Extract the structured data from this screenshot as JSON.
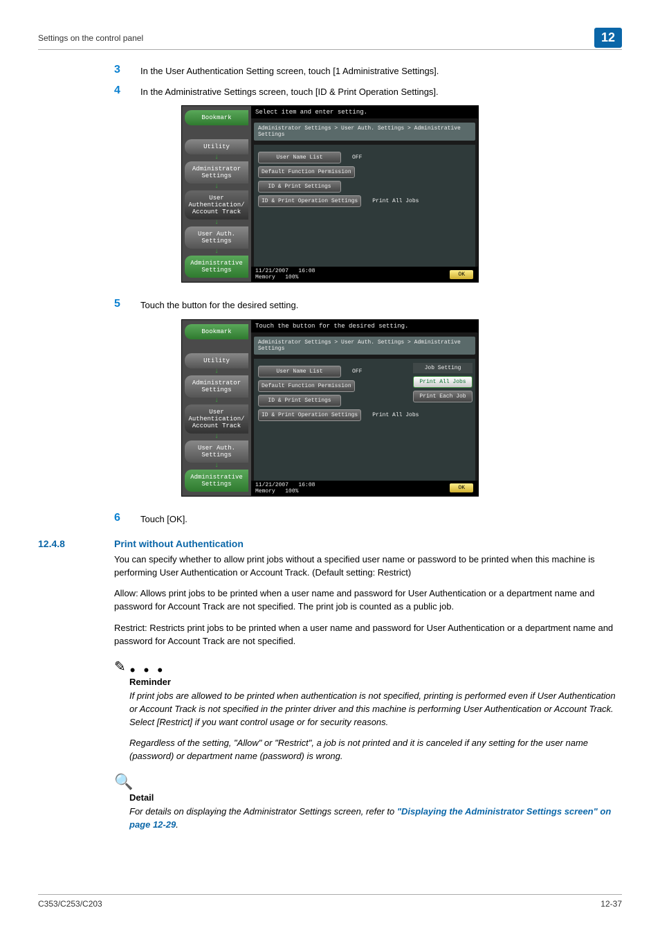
{
  "header": {
    "title": "Settings on the control panel",
    "chapter": "12"
  },
  "steps": {
    "s3": {
      "num": "3",
      "text": "In the User Authentication Setting screen, touch [1 Administrative Settings]."
    },
    "s4": {
      "num": "4",
      "text": "In the Administrative Settings screen, touch [ID & Print Operation Settings]."
    },
    "s5": {
      "num": "5",
      "text": "Touch the button for the desired setting."
    },
    "s6": {
      "num": "6",
      "text": "Touch [OK]."
    }
  },
  "screen1": {
    "banner": "Select item and enter setting.",
    "crumb": "Administrator Settings > User Auth. Settings > Administrative Settings",
    "left": {
      "bookmark": "Bookmark",
      "utility": "Utility",
      "admin": "Administrator Settings",
      "userauth_track": "User Authentication/ Account Track",
      "userauth": "User Auth. Settings",
      "adminset": "Administrative Settings"
    },
    "rows": {
      "r1_label": "User Name List",
      "r1_val": "OFF",
      "r2_label": "Default Function Permission",
      "r3_label": "ID & Print Settings",
      "r4_label": "ID & Print Operation Settings",
      "r4_val": "Print All Jobs"
    },
    "foot": {
      "date": "11/21/2007",
      "time": "16:08",
      "mem": "Memory",
      "pct": "100%",
      "ok": "OK"
    }
  },
  "screen2": {
    "banner": "Touch the button for the desired setting.",
    "crumb": "Administrator Settings > User Auth. Settings > Administrative Settings",
    "side": {
      "hdr": "Job Setting",
      "opt1": "Print All Jobs",
      "opt2": "Print Each Job"
    },
    "foot_ok": "OK"
  },
  "section": {
    "num": "12.4.8",
    "title": "Print without Authentication"
  },
  "paras": {
    "p1": "You can specify whether to allow print jobs without a specified user name or password to be printed when this machine is performing User Authentication or Account Track. (Default setting: Restrict)",
    "p2": "Allow: Allows print jobs to be printed when a user name and password for User Authentication or a department name and password for Account Track are not specified. The print job is counted as a public job.",
    "p3": "Restrict: Restricts print jobs to be printed when a user name and password for User Authentication or a department name and password for Account Track are not specified."
  },
  "reminder": {
    "label": "Reminder",
    "n1": "If print jobs are allowed to be printed when authentication is not specified, printing is performed even if User Authentication or Account Track is not specified in the printer driver and this machine is performing User Authentication or Account Track. Select [Restrict] if you want control usage or for security reasons.",
    "n2": "Regardless of the setting, \"Allow\" or \"Restrict\", a job is not printed and it is canceled if any setting for the user name (password) or department name (password) is wrong."
  },
  "detail": {
    "label": "Detail",
    "pre": "For details on displaying the Administrator Settings screen, refer to ",
    "link": "\"Displaying the Administrator Settings screen\" on page 12-29",
    "post": "."
  },
  "footer": {
    "model": "C353/C253/C203",
    "page": "12-37"
  }
}
